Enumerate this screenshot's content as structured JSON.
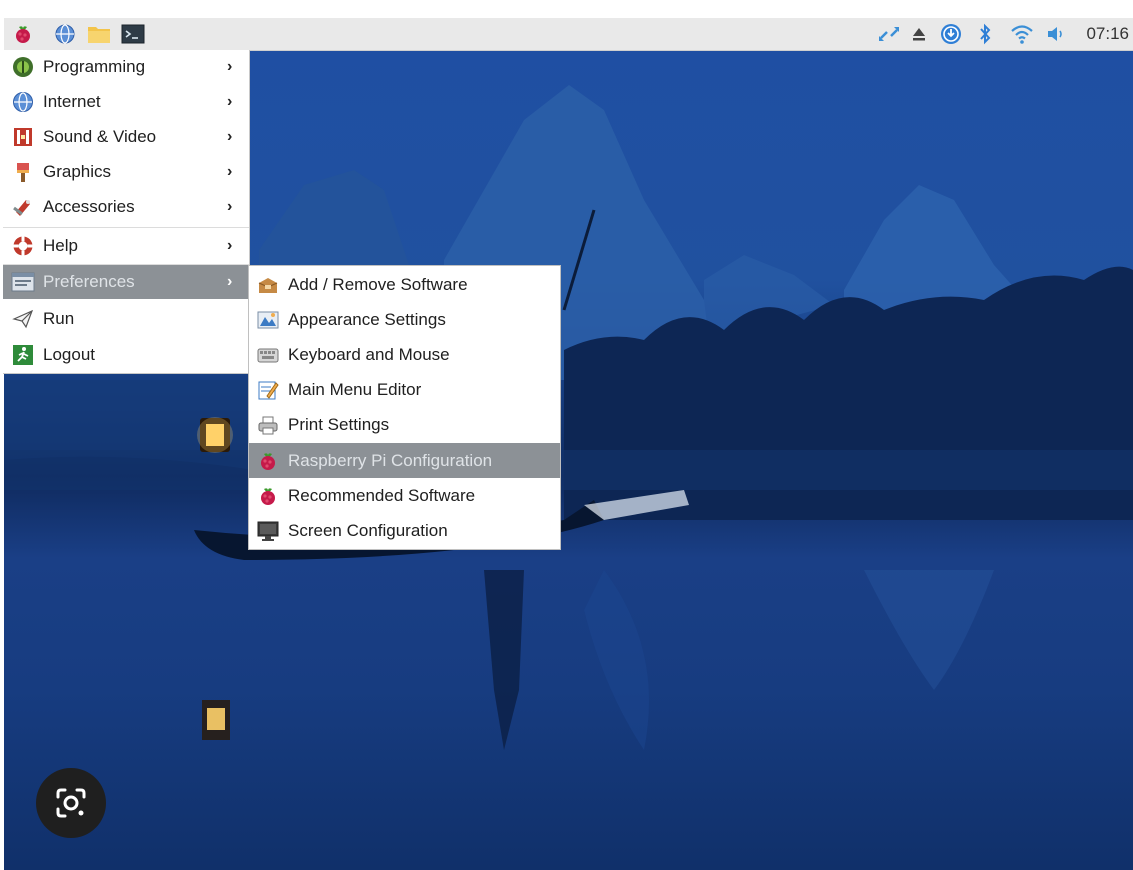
{
  "taskbar": {
    "launchers": [
      {
        "name": "raspberry-menu",
        "icon": "raspberry-icon"
      },
      {
        "name": "web-browser",
        "icon": "globe-icon"
      },
      {
        "name": "file-manager",
        "icon": "folder-icon"
      },
      {
        "name": "terminal",
        "icon": "terminal-icon"
      }
    ],
    "tray_icons": [
      "network-transfer-icon",
      "eject-icon",
      "download-icon",
      "bluetooth-icon",
      "wifi-icon",
      "volume-icon"
    ],
    "clock": "07:16"
  },
  "main_menu": {
    "items": [
      {
        "label": "Programming",
        "icon": "programming-icon",
        "has_submenu": true
      },
      {
        "label": "Internet",
        "icon": "globe-icon",
        "has_submenu": true
      },
      {
        "label": "Sound & Video",
        "icon": "sound-video-icon",
        "has_submenu": true
      },
      {
        "label": "Graphics",
        "icon": "paintbrush-icon",
        "has_submenu": true
      },
      {
        "label": "Accessories",
        "icon": "accessories-icon",
        "has_submenu": true
      },
      {
        "label": "Help",
        "icon": "lifebuoy-icon",
        "has_submenu": true
      },
      {
        "label": "Preferences",
        "icon": "preferences-icon",
        "has_submenu": true,
        "active": true
      },
      {
        "label": "Run",
        "icon": "paper-plane-icon",
        "has_submenu": false
      },
      {
        "label": "Logout",
        "icon": "logout-icon",
        "has_submenu": false
      }
    ],
    "arrow_glyph": "›"
  },
  "preferences_submenu": {
    "items": [
      {
        "label": "Add / Remove Software",
        "icon": "package-icon"
      },
      {
        "label": "Appearance Settings",
        "icon": "appearance-icon"
      },
      {
        "label": "Keyboard and Mouse",
        "icon": "keyboard-icon"
      },
      {
        "label": "Main Menu Editor",
        "icon": "menu-editor-icon"
      },
      {
        "label": "Print Settings",
        "icon": "printer-icon"
      },
      {
        "label": "Raspberry Pi Configuration",
        "icon": "raspberry-icon",
        "active": true
      },
      {
        "label": "Recommended Software",
        "icon": "raspberry-icon"
      },
      {
        "label": "Screen Configuration",
        "icon": "monitor-icon"
      }
    ]
  },
  "colors": {
    "menu_highlight": "#8c9196",
    "taskbar_bg": "#e9e9e9",
    "wallpaper_blue": "#1f4fa3",
    "raspberry_red": "#c51a4a"
  },
  "overlay": {
    "lens_button_icon": "screenshot-lens-icon"
  }
}
